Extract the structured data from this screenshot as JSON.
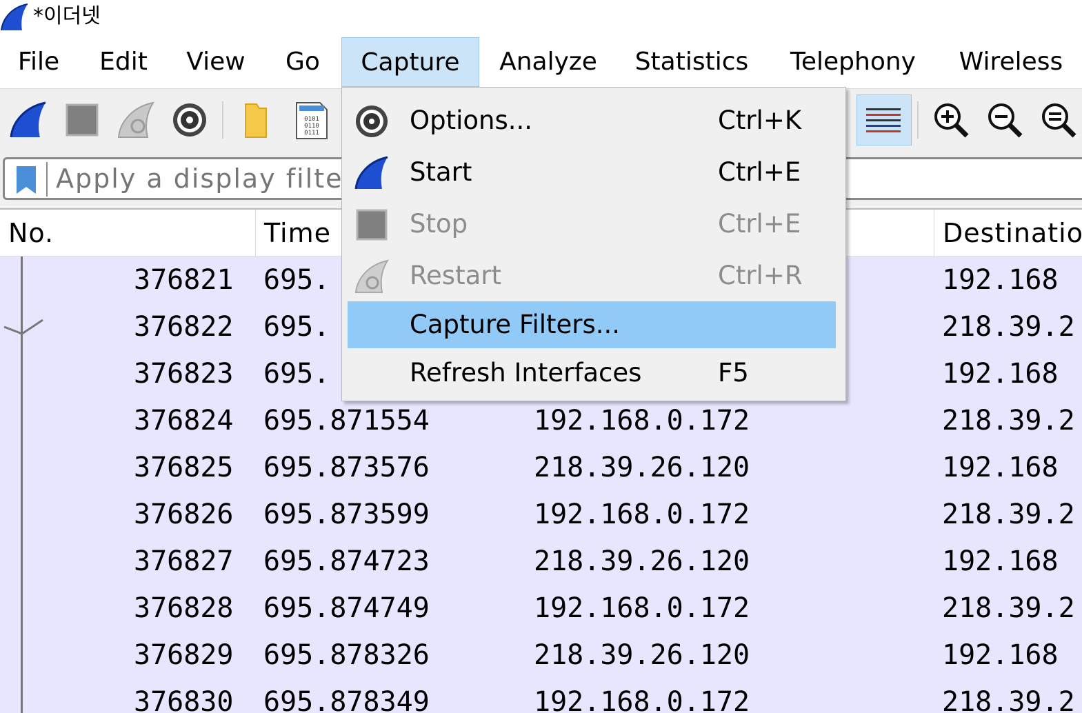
{
  "window": {
    "title": "*이더넷"
  },
  "menubar": {
    "items": [
      {
        "label": "File"
      },
      {
        "label": "Edit"
      },
      {
        "label": "View"
      },
      {
        "label": "Go"
      },
      {
        "label": "Capture"
      },
      {
        "label": "Analyze"
      },
      {
        "label": "Statistics"
      },
      {
        "label": "Telephony"
      },
      {
        "label": "Wireless"
      }
    ],
    "open_menu": "Capture"
  },
  "toolbar": {
    "icons": [
      "shark-fin-start-icon",
      "stop-square-icon",
      "restart-shark-icon",
      "options-gear-icon",
      "open-folder-icon",
      "binary-file-icon",
      "colorize-lines-icon",
      "zoom-in-icon",
      "zoom-out-icon",
      "zoom-normal-icon"
    ]
  },
  "filter": {
    "placeholder": "Apply a display filter …"
  },
  "columns": {
    "no": "No.",
    "time": "Time",
    "destination": "Destination"
  },
  "capture_menu": {
    "items": [
      {
        "label": "Options...",
        "shortcut": "Ctrl+K",
        "icon": "gear-icon",
        "enabled": true
      },
      {
        "label": "Start",
        "shortcut": "Ctrl+E",
        "icon": "shark-fin-icon",
        "enabled": true
      },
      {
        "label": "Stop",
        "shortcut": "Ctrl+E",
        "icon": "stop-square-icon",
        "enabled": false
      },
      {
        "label": "Restart",
        "shortcut": "Ctrl+R",
        "icon": "restart-icon",
        "enabled": false
      },
      {
        "label": "Capture Filters...",
        "shortcut": "",
        "icon": "",
        "enabled": true,
        "highlighted": true
      },
      {
        "label": "Refresh Interfaces",
        "shortcut": "F5",
        "icon": "",
        "enabled": true
      }
    ]
  },
  "packets": {
    "rows": [
      {
        "no": "376821",
        "time": "695.",
        "source": "",
        "destination": "192.168"
      },
      {
        "no": "376822",
        "time": "695.",
        "source": "",
        "destination": "218.39.2"
      },
      {
        "no": "376823",
        "time": "695.",
        "source": "",
        "destination": "192.168"
      },
      {
        "no": "376824",
        "time": "695.871554",
        "source": "192.168.0.172",
        "destination": "218.39.2"
      },
      {
        "no": "376825",
        "time": "695.873576",
        "source": "218.39.26.120",
        "destination": "192.168"
      },
      {
        "no": "376826",
        "time": "695.873599",
        "source": "192.168.0.172",
        "destination": "218.39.2"
      },
      {
        "no": "376827",
        "time": "695.874723",
        "source": "218.39.26.120",
        "destination": "192.168"
      },
      {
        "no": "376828",
        "time": "695.874749",
        "source": "192.168.0.172",
        "destination": "218.39.2"
      },
      {
        "no": "376829",
        "time": "695.878326",
        "source": "218.39.26.120",
        "destination": "192.168"
      },
      {
        "no": "376830",
        "time": "695.878349",
        "source": "192.168.0.172",
        "destination": "218.39.2"
      }
    ]
  },
  "colors": {
    "menu_open_bg": "#cce4f7",
    "menu_highlight": "#91c9f7",
    "packet_row_bg": "#e7e6fe",
    "shark_blue": "#1f4fd1"
  }
}
